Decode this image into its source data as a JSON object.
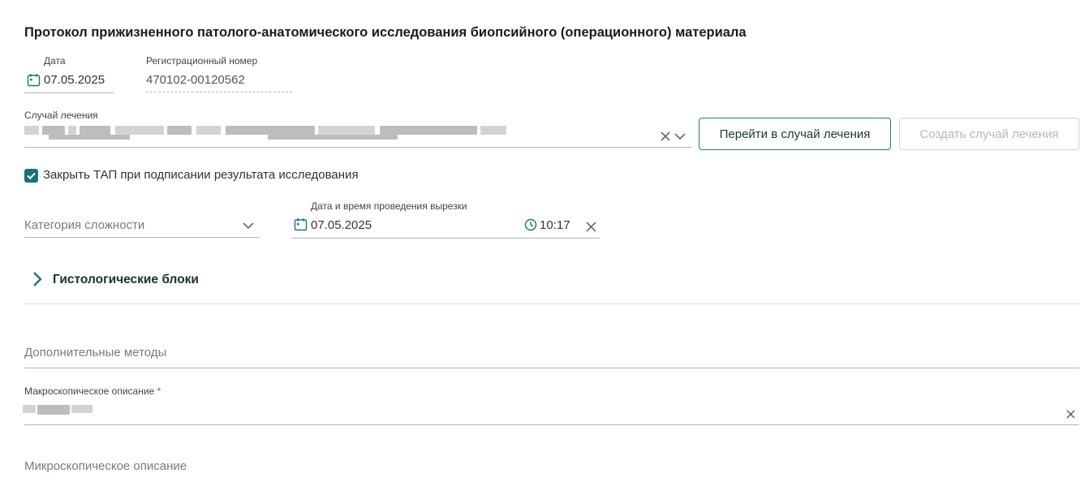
{
  "protocol": {
    "title": "Протокол прижизненного патолого-анатомического исследования биопсийного (операционного) материала"
  },
  "date_field": {
    "label": "Дата",
    "value": "07.05.2025",
    "icon": "calendar-icon"
  },
  "reg_number": {
    "label": "Регистрационный номер",
    "value": "470102-00120562"
  },
  "treatment_case": {
    "label": "Случай лечения",
    "clear_icon": "close-icon",
    "dropdown_icon": "chevron-down-icon",
    "goto_button": "Перейти в случай лечения",
    "create_button": "Создать случай лечения"
  },
  "close_tap": {
    "label": "Закрыть ТАП при подписании результата исследования",
    "checked": true
  },
  "complexity": {
    "placeholder": "Категория сложности",
    "dropdown_icon": "chevron-down-icon"
  },
  "cutting": {
    "label": "Дата и время проведения вырезки",
    "date": "07.05.2025",
    "time": "10:17",
    "date_icon": "calendar-icon",
    "time_icon": "clock-icon",
    "clear_icon": "close-icon"
  },
  "histology": {
    "title": "Гистологические блоки",
    "expand_icon": "chevron-right-icon"
  },
  "additional_methods": {
    "placeholder": "Дополнительные методы"
  },
  "macro": {
    "label": "Макроскопическое описание",
    "required_mark": "*",
    "clear_icon": "close-icon"
  },
  "micro": {
    "placeholder": "Микроскопическое описание"
  },
  "colors": {
    "accent": "#1a7378",
    "required": "#d9362b",
    "border": "#b5b5b5"
  }
}
